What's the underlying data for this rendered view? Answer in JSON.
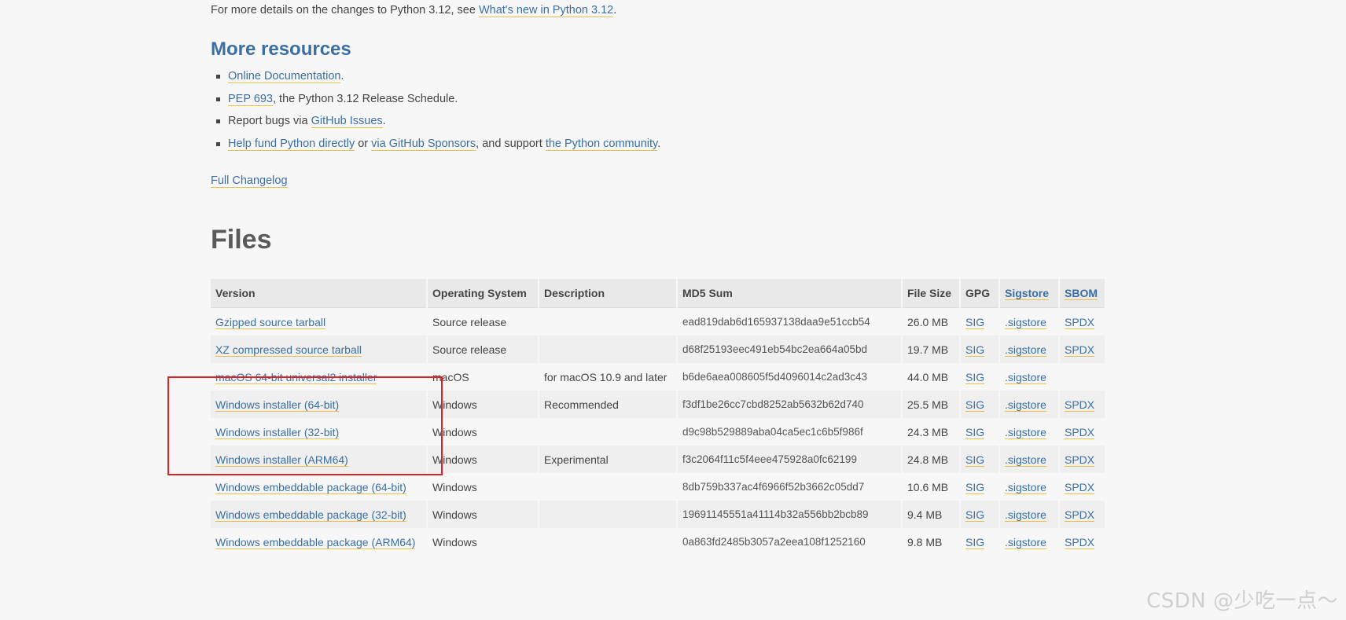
{
  "intro": {
    "prefix": "For more details on the changes to Python 3.12, see ",
    "link": "What's new in Python 3.12",
    "suffix": "."
  },
  "resources": {
    "title": "More resources",
    "items": [
      {
        "parts": [
          {
            "link": "Online Documentation"
          },
          {
            "text": "."
          }
        ]
      },
      {
        "parts": [
          {
            "link": "PEP 693"
          },
          {
            "text": ", the Python 3.12 Release Schedule."
          }
        ]
      },
      {
        "parts": [
          {
            "text": "Report bugs via "
          },
          {
            "link": "GitHub Issues"
          },
          {
            "text": "."
          }
        ]
      },
      {
        "parts": [
          {
            "link": "Help fund Python directly"
          },
          {
            "text": " or "
          },
          {
            "link": "via GitHub Sponsors"
          },
          {
            "text": ", and support "
          },
          {
            "link": "the Python community"
          },
          {
            "text": "."
          }
        ]
      }
    ]
  },
  "changelog_link": "Full Changelog",
  "files": {
    "title": "Files",
    "headers": [
      "Version",
      "Operating System",
      "Description",
      "MD5 Sum",
      "File Size",
      "GPG",
      "Sigstore",
      "SBOM"
    ],
    "rows": [
      {
        "version": "Gzipped source tarball",
        "os": "Source release",
        "description": "",
        "md5": "ead819dab6d165937138daa9e51ccb54",
        "size": "26.0 MB",
        "gpg": "SIG",
        "sigstore": ".sigstore",
        "sbom": "SPDX"
      },
      {
        "version": "XZ compressed source tarball",
        "os": "Source release",
        "description": "",
        "md5": "d68f25193eec491eb54bc2ea664a05bd",
        "size": "19.7 MB",
        "gpg": "SIG",
        "sigstore": ".sigstore",
        "sbom": "SPDX"
      },
      {
        "version": "macOS 64-bit universal2 installer",
        "os": "macOS",
        "description": "for macOS 10.9 and later",
        "md5": "b6de6aea008605f5d4096014c2ad3c43",
        "size": "44.0 MB",
        "gpg": "SIG",
        "sigstore": ".sigstore",
        "sbom": ""
      },
      {
        "version": "Windows installer (64-bit)",
        "os": "Windows",
        "description": "Recommended",
        "md5": "f3df1be26cc7cbd8252ab5632b62d740",
        "size": "25.5 MB",
        "gpg": "SIG",
        "sigstore": ".sigstore",
        "sbom": "SPDX"
      },
      {
        "version": "Windows installer (32-bit)",
        "os": "Windows",
        "description": "",
        "md5": "d9c98b529889aba04ca5ec1c6b5f986f",
        "size": "24.3 MB",
        "gpg": "SIG",
        "sigstore": ".sigstore",
        "sbom": "SPDX"
      },
      {
        "version": "Windows installer (ARM64)",
        "os": "Windows",
        "description": "Experimental",
        "md5": "f3c2064f11c5f4eee475928a0fc62199",
        "size": "24.8 MB",
        "gpg": "SIG",
        "sigstore": ".sigstore",
        "sbom": "SPDX"
      },
      {
        "version": "Windows embeddable package (64-bit)",
        "os": "Windows",
        "description": "",
        "md5": "8db759b337ac4f6966f52b3662c05dd7",
        "size": "10.6 MB",
        "gpg": "SIG",
        "sigstore": ".sigstore",
        "sbom": "SPDX"
      },
      {
        "version": "Windows embeddable package (32-bit)",
        "os": "Windows",
        "description": "",
        "md5": "19691145551a41114b32a556bb2bcb89",
        "size": "9.4 MB",
        "gpg": "SIG",
        "sigstore": ".sigstore",
        "sbom": "SPDX"
      },
      {
        "version": "Windows embeddable package (ARM64)",
        "os": "Windows",
        "description": "",
        "md5": "0a863fd2485b3057a2eea108f1252160",
        "size": "9.8 MB",
        "gpg": "SIG",
        "sigstore": ".sigstore",
        "sbom": "SPDX"
      }
    ]
  },
  "watermark": "CSDN @少吃一点～",
  "colors": {
    "link": "#3b6fa4",
    "link_underline": "#e8c04a",
    "highlight_box": "#e02020",
    "background": "#f7f7f7"
  }
}
